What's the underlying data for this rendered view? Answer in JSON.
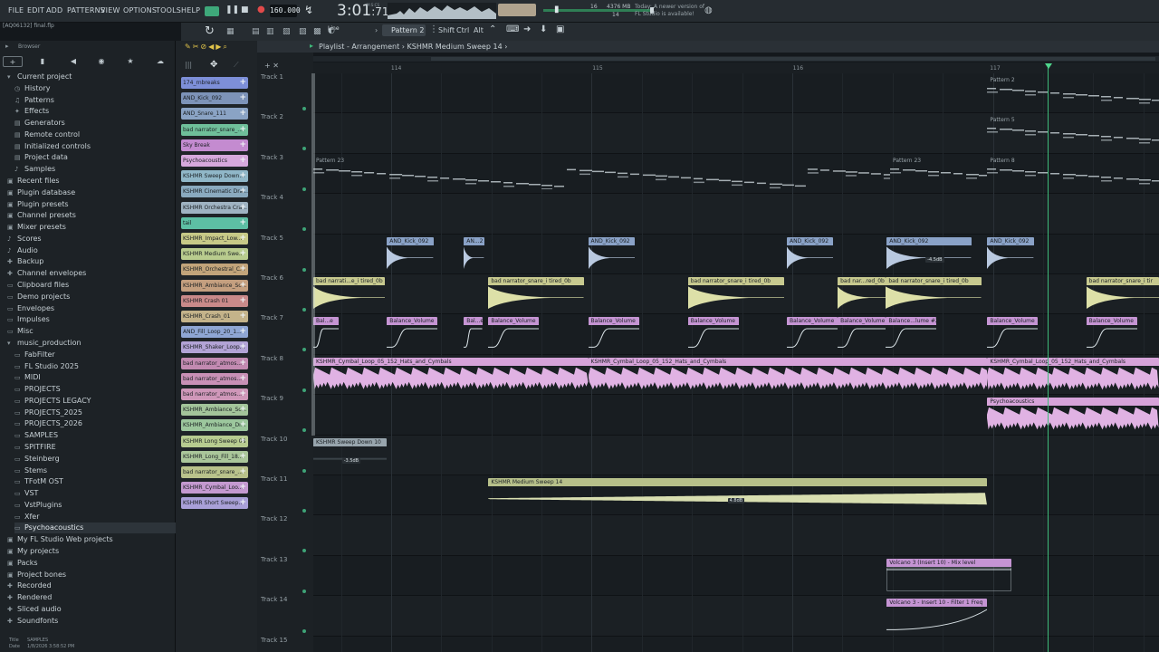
{
  "menu": [
    "FILE",
    "EDIT",
    "ADD",
    "PATTERNS",
    "VIEW",
    "OPTIONS",
    "TOOLS",
    "HELP"
  ],
  "transport": {
    "tempo": "160.000",
    "time": "3:01",
    "time_frac": ":71",
    "time_sub": "M:S:CS",
    "cpu_value": "16",
    "mem_value": "4376 MB",
    "mem_sub": "14",
    "news_line1": "Today: A newer version of",
    "news_line2": "FL Studio is available!"
  },
  "toolbar": {
    "project_hint": "[AQ06132] final.flp",
    "snap_label": "Line",
    "pattern_label": "Pattern 2",
    "shift_label": "Shift",
    "ctrl_label": "Ctrl",
    "alt_label": "Alt"
  },
  "browser": {
    "title": "Browser",
    "items": [
      {
        "label": "Current project",
        "icon": "folder-open-icon",
        "glyph": "▾",
        "depth": 0
      },
      {
        "label": "History",
        "icon": "history-icon",
        "glyph": "◷",
        "depth": 1
      },
      {
        "label": "Patterns",
        "icon": "pattern-icon",
        "glyph": "♫",
        "depth": 1
      },
      {
        "label": "Effects",
        "icon": "effects-icon",
        "glyph": "✦",
        "depth": 1
      },
      {
        "label": "Generators",
        "icon": "generator-icon",
        "glyph": "▤",
        "depth": 1
      },
      {
        "label": "Remote control",
        "icon": "remote-icon",
        "glyph": "▤",
        "depth": 1
      },
      {
        "label": "Initialized controls",
        "icon": "controls-icon",
        "glyph": "▤",
        "depth": 1
      },
      {
        "label": "Project data",
        "icon": "data-icon",
        "glyph": "▤",
        "depth": 1
      },
      {
        "label": "Samples",
        "icon": "samples-icon",
        "glyph": "♪",
        "depth": 1
      },
      {
        "label": "Recent files",
        "icon": "recent-icon",
        "glyph": "▣",
        "depth": 0
      },
      {
        "label": "Plugin database",
        "icon": "plugin-db-icon",
        "glyph": "▣",
        "depth": 0
      },
      {
        "label": "Plugin presets",
        "icon": "plugin-preset-icon",
        "glyph": "▣",
        "depth": 0
      },
      {
        "label": "Channel presets",
        "icon": "channel-preset-icon",
        "glyph": "▣",
        "depth": 0
      },
      {
        "label": "Mixer presets",
        "icon": "mixer-preset-icon",
        "glyph": "▣",
        "depth": 0
      },
      {
        "label": "Scores",
        "icon": "scores-icon",
        "glyph": "♪",
        "depth": 0
      },
      {
        "label": "Audio",
        "icon": "audio-icon",
        "glyph": "♪",
        "depth": 0
      },
      {
        "label": "Backup",
        "icon": "backup-icon",
        "glyph": "✚",
        "depth": 0
      },
      {
        "label": "Channel envelopes",
        "icon": "envelope-icon",
        "glyph": "✚",
        "depth": 0
      },
      {
        "label": "Clipboard files",
        "icon": "clipboard-icon",
        "glyph": "▭",
        "depth": 0
      },
      {
        "label": "Demo projects",
        "icon": "demo-icon",
        "glyph": "▭",
        "depth": 0
      },
      {
        "label": "Envelopes",
        "icon": "envelopes-icon",
        "glyph": "▭",
        "depth": 0
      },
      {
        "label": "Impulses",
        "icon": "impulses-icon",
        "glyph": "▭",
        "depth": 0
      },
      {
        "label": "Misc",
        "icon": "misc-icon",
        "glyph": "▭",
        "depth": 0
      },
      {
        "label": "music_production",
        "icon": "folder-open-icon",
        "glyph": "▾",
        "depth": 0
      },
      {
        "label": "FabFilter",
        "icon": "folder-icon",
        "glyph": "▭",
        "depth": 1
      },
      {
        "label": "FL Studio 2025",
        "icon": "folder-icon",
        "glyph": "▭",
        "depth": 1
      },
      {
        "label": "MIDI",
        "icon": "folder-icon",
        "glyph": "▭",
        "depth": 1
      },
      {
        "label": "PROJECTS",
        "icon": "folder-icon",
        "glyph": "▭",
        "depth": 1
      },
      {
        "label": "PROJECTS LEGACY",
        "icon": "folder-icon",
        "glyph": "▭",
        "depth": 1
      },
      {
        "label": "PROJECTS_2025",
        "icon": "folder-icon",
        "glyph": "▭",
        "depth": 1
      },
      {
        "label": "PROJECTS_2026",
        "icon": "folder-icon",
        "glyph": "▭",
        "depth": 1
      },
      {
        "label": "SAMPLES",
        "icon": "folder-icon",
        "glyph": "▭",
        "depth": 1
      },
      {
        "label": "SPITFIRE",
        "icon": "folder-icon",
        "glyph": "▭",
        "depth": 1
      },
      {
        "label": "Steinberg",
        "icon": "folder-icon",
        "glyph": "▭",
        "depth": 1
      },
      {
        "label": "Stems",
        "icon": "folder-icon",
        "glyph": "▭",
        "depth": 1
      },
      {
        "label": "TFotM OST",
        "icon": "folder-icon",
        "glyph": "▭",
        "depth": 1
      },
      {
        "label": "VST",
        "icon": "folder-icon",
        "glyph": "▭",
        "depth": 1
      },
      {
        "label": "VstPlugins",
        "icon": "folder-icon",
        "glyph": "▭",
        "depth": 1
      },
      {
        "label": "Xfer",
        "icon": "folder-icon",
        "glyph": "▭",
        "depth": 1
      },
      {
        "label": "Psychoacoustics",
        "icon": "folder-icon",
        "glyph": "▭",
        "depth": 1,
        "selected": true
      },
      {
        "label": "My FL Studio Web projects",
        "icon": "web-icon",
        "glyph": "▣",
        "depth": 0
      },
      {
        "label": "My projects",
        "icon": "projects-icon",
        "glyph": "▣",
        "depth": 0
      },
      {
        "label": "Packs",
        "icon": "packs-icon",
        "glyph": "▣",
        "depth": 0
      },
      {
        "label": "Project bones",
        "icon": "bones-icon",
        "glyph": "▣",
        "depth": 0
      },
      {
        "label": "Recorded",
        "icon": "recorded-icon",
        "glyph": "✚",
        "depth": 0
      },
      {
        "label": "Rendered",
        "icon": "rendered-icon",
        "glyph": "✚",
        "depth": 0
      },
      {
        "label": "Sliced audio",
        "icon": "sliced-icon",
        "glyph": "✚",
        "depth": 0
      },
      {
        "label": "Soundfonts",
        "icon": "soundfonts-icon",
        "glyph": "✚",
        "depth": 0
      }
    ],
    "status_title_key": "Title",
    "status_title_val": "SAMPLES",
    "status_date_key": "Date",
    "status_date_val": "1/8/2026 3:58:52 PM"
  },
  "channels": [
    {
      "label": "174_rnbreaks",
      "color": "#7d8fd8"
    },
    {
      "label": "AND_Kick_092",
      "color": "#7d93b8"
    },
    {
      "label": "AND_Snare_111",
      "color": "#8aa3c4"
    },
    {
      "label": "bad narrator_snare_...",
      "color": "#6fbf9a"
    },
    {
      "label": "Sky Break",
      "color": "#c48bd0"
    },
    {
      "label": "Psychoacoustics",
      "color": "#d6a8dc"
    },
    {
      "label": "KSHMR Sweep Down...",
      "color": "#90b7c8"
    },
    {
      "label": "KSHMR Cinematic Dra...",
      "color": "#8aaabf"
    },
    {
      "label": "KSHMR Orchestra Cra...",
      "color": "#9fb3c2"
    },
    {
      "label": "tail",
      "color": "#5dbfa4"
    },
    {
      "label": "KSHMR_Impact_Low...",
      "color": "#c7c987"
    },
    {
      "label": "KSHMR Medium Swe...",
      "color": "#b9cc8e"
    },
    {
      "label": "KSHMR_Orchestral_C...",
      "color": "#c2a47a"
    },
    {
      "label": "KSHMR_Ambiance_Sc...",
      "color": "#c49f7f"
    },
    {
      "label": "KSHMR Crash 01",
      "color": "#c98a8a"
    },
    {
      "label": "KSHMR_Crash_01",
      "color": "#c4b38a"
    },
    {
      "label": "AND_Fill_Loop_20_1...",
      "color": "#8fa6d4"
    },
    {
      "label": "KSHMR_Shaker_Loop...",
      "color": "#b2a3d6"
    },
    {
      "label": "bad narrator_atmos...",
      "color": "#c28ab1"
    },
    {
      "label": "bad narrator_atmos...",
      "color": "#c890b6"
    },
    {
      "label": "bad narrator_atmos...",
      "color": "#cf97b9"
    },
    {
      "label": "KSHMR_Ambiance_Sc...",
      "color": "#a3c49a"
    },
    {
      "label": "KSHMR_Ambiance_Dr...",
      "color": "#9cc79d"
    },
    {
      "label": "KSHMR Long Sweep 08",
      "color": "#b7cc90"
    },
    {
      "label": "KSHMR_Long_Fill_18...",
      "color": "#aac69a"
    },
    {
      "label": "bad narrator_snare_...",
      "color": "#b9c28b"
    },
    {
      "label": "KSHMR_Cymbal_Loo...",
      "color": "#c499d0"
    },
    {
      "label": "KSHMR Short Sweep...",
      "color": "#a9a0d8"
    }
  ],
  "playlist": {
    "breadcrumb_prefix": "Playlist - Arrangement",
    "breadcrumb_sep": "›",
    "breadcrumb_item": "KSHMR Medium Sweep 14",
    "ruler": [
      {
        "label": "114",
        "pos": 0.092
      },
      {
        "label": "115",
        "pos": 0.33
      },
      {
        "label": "116",
        "pos": 0.567
      },
      {
        "label": "117",
        "pos": 0.8
      }
    ],
    "tracks": [
      "Track 1",
      "Track 2",
      "Track 3",
      "Track 4",
      "Track 5",
      "Track 6",
      "Track 7",
      "Track 8",
      "Track 9",
      "Track 10",
      "Track 11",
      "Track 12",
      "Track 13",
      "Track 14",
      "Track 15"
    ],
    "clips": [
      {
        "track": 0,
        "start": 0.797,
        "end": 1.0,
        "label": "Pattern 2",
        "kind": "pattern",
        "color": "#2c3238"
      },
      {
        "track": 1,
        "start": 0.797,
        "end": 1.0,
        "label": "Pattern 5",
        "kind": "pattern",
        "color": "#2c3238"
      },
      {
        "track": 2,
        "start": 0.0,
        "end": 0.682,
        "label": "Pattern 23",
        "kind": "pattern",
        "color": "#2c3238"
      },
      {
        "track": 2,
        "start": 0.682,
        "end": 0.797,
        "label": "Pattern 23",
        "kind": "pattern",
        "color": "#2c3238"
      },
      {
        "track": 2,
        "start": 0.797,
        "end": 1.0,
        "label": "Pattern 8",
        "kind": "pattern",
        "color": "#2c3238"
      },
      {
        "track": 4,
        "start": 0.087,
        "end": 0.142,
        "label": "AND_Kick_092",
        "kind": "kick",
        "color": "#8aa2c7"
      },
      {
        "track": 4,
        "start": 0.178,
        "end": 0.202,
        "label": "AN...2",
        "kind": "kick",
        "color": "#8aa2c7"
      },
      {
        "track": 4,
        "start": 0.325,
        "end": 0.38,
        "label": "AND_Kick_092",
        "kind": "kick",
        "color": "#8aa2c7"
      },
      {
        "track": 4,
        "start": 0.56,
        "end": 0.615,
        "label": "AND_Kick_092",
        "kind": "kick",
        "color": "#8aa2c7"
      },
      {
        "track": 4,
        "start": 0.678,
        "end": 0.778,
        "label": "AND_Kick_092",
        "kind": "kick",
        "color": "#8aa2c7"
      },
      {
        "track": 4,
        "start": 0.797,
        "end": 0.852,
        "label": "AND_Kick_092",
        "kind": "kick",
        "color": "#8aa2c7"
      },
      {
        "track": 5,
        "start": 0.0,
        "end": 0.085,
        "label": "bad narrati...e_i tired_0b",
        "kind": "snare",
        "color": "#c7c98f"
      },
      {
        "track": 5,
        "start": 0.207,
        "end": 0.32,
        "label": "bad narrator_snare_i tired_0b",
        "kind": "snare",
        "color": "#c7c98f"
      },
      {
        "track": 5,
        "start": 0.443,
        "end": 0.557,
        "label": "bad narrator_snare_i tired_0b",
        "kind": "snare",
        "color": "#c7c98f"
      },
      {
        "track": 5,
        "start": 0.62,
        "end": 0.677,
        "label": "bad nar...red_0b",
        "kind": "snare",
        "color": "#c7c98f"
      },
      {
        "track": 5,
        "start": 0.677,
        "end": 0.79,
        "label": "bad narrator_snare_i tired_0b",
        "kind": "snare",
        "color": "#c7c98f"
      },
      {
        "track": 5,
        "start": 0.914,
        "end": 1.0,
        "label": "bad narrator_snare_i tir",
        "kind": "snare",
        "color": "#c7c98f"
      },
      {
        "track": 6,
        "start": 0.0,
        "end": 0.03,
        "label": "Bal...e",
        "kind": "auto",
        "color": "#c594d3"
      },
      {
        "track": 6,
        "start": 0.087,
        "end": 0.147,
        "label": "Balance_Volume",
        "kind": "auto",
        "color": "#c594d3"
      },
      {
        "track": 6,
        "start": 0.178,
        "end": 0.2,
        "label": "Bal...e",
        "kind": "auto",
        "color": "#c594d3"
      },
      {
        "track": 6,
        "start": 0.207,
        "end": 0.267,
        "label": "Balance_Volume",
        "kind": "auto",
        "color": "#c594d3"
      },
      {
        "track": 6,
        "start": 0.325,
        "end": 0.385,
        "label": "Balance_Volume",
        "kind": "auto",
        "color": "#c594d3"
      },
      {
        "track": 6,
        "start": 0.443,
        "end": 0.503,
        "label": "Balance_Volume",
        "kind": "auto",
        "color": "#c594d3"
      },
      {
        "track": 6,
        "start": 0.56,
        "end": 0.62,
        "label": "Balance_Volume",
        "kind": "auto",
        "color": "#c594d3"
      },
      {
        "track": 6,
        "start": 0.62,
        "end": 0.677,
        "label": "Balance_Volume",
        "kind": "auto",
        "color": "#c594d3"
      },
      {
        "track": 6,
        "start": 0.677,
        "end": 0.737,
        "label": "Balance...lume #2",
        "kind": "auto",
        "color": "#c594d3"
      },
      {
        "track": 6,
        "start": 0.797,
        "end": 0.857,
        "label": "Balance_Volume",
        "kind": "auto",
        "color": "#c594d3"
      },
      {
        "track": 6,
        "start": 0.914,
        "end": 0.974,
        "label": "Balance_Volume",
        "kind": "auto",
        "color": "#c594d3"
      },
      {
        "track": 7,
        "start": 0.0,
        "end": 0.325,
        "label": "KSHMR_Cymbal_Loop_05_152_Hats_and_Cymbals",
        "kind": "loop",
        "color": "#d6a3d9"
      },
      {
        "track": 7,
        "start": 0.325,
        "end": 0.797,
        "label": "KSHMR_Cymbal_Loop_05_152_Hats_and_Cymbals",
        "kind": "loop",
        "color": "#d6a3d9"
      },
      {
        "track": 7,
        "start": 0.797,
        "end": 1.0,
        "label": "KSHMR_Cymbal_Loop_05_152_Hats_and_Cymbals",
        "kind": "loop",
        "color": "#d6a3d9"
      },
      {
        "track": 8,
        "start": 0.797,
        "end": 1.0,
        "label": "Psychoacoustics",
        "kind": "loop",
        "color": "#d6a3d9"
      },
      {
        "track": 9,
        "start": 0.0,
        "end": 0.087,
        "label": "KSHMR Sweep Down 10",
        "kind": "sweep",
        "color": "#98a5ad"
      },
      {
        "track": 10,
        "start": 0.207,
        "end": 0.797,
        "label": "KSHMR Medium Sweep 14",
        "kind": "sweep-up",
        "color": "#b7c08a"
      },
      {
        "track": 12,
        "start": 0.678,
        "end": 0.826,
        "label": "Volcano 3 (Insert 10) - Mix level",
        "kind": "env-flat",
        "color": "#c594d3"
      },
      {
        "track": 13,
        "start": 0.678,
        "end": 0.797,
        "label": "Volcano 3 - Insert 10 - Filter 1 Freq",
        "kind": "env-rise",
        "color": "#c594d3"
      }
    ],
    "badges": [
      {
        "track": 4,
        "pos": 0.724,
        "text": "-4.5dB"
      },
      {
        "track": 9,
        "pos": 0.034,
        "text": "-3.5dB"
      },
      {
        "track": 10,
        "pos": 0.49,
        "text": "4.8dB"
      }
    ]
  }
}
